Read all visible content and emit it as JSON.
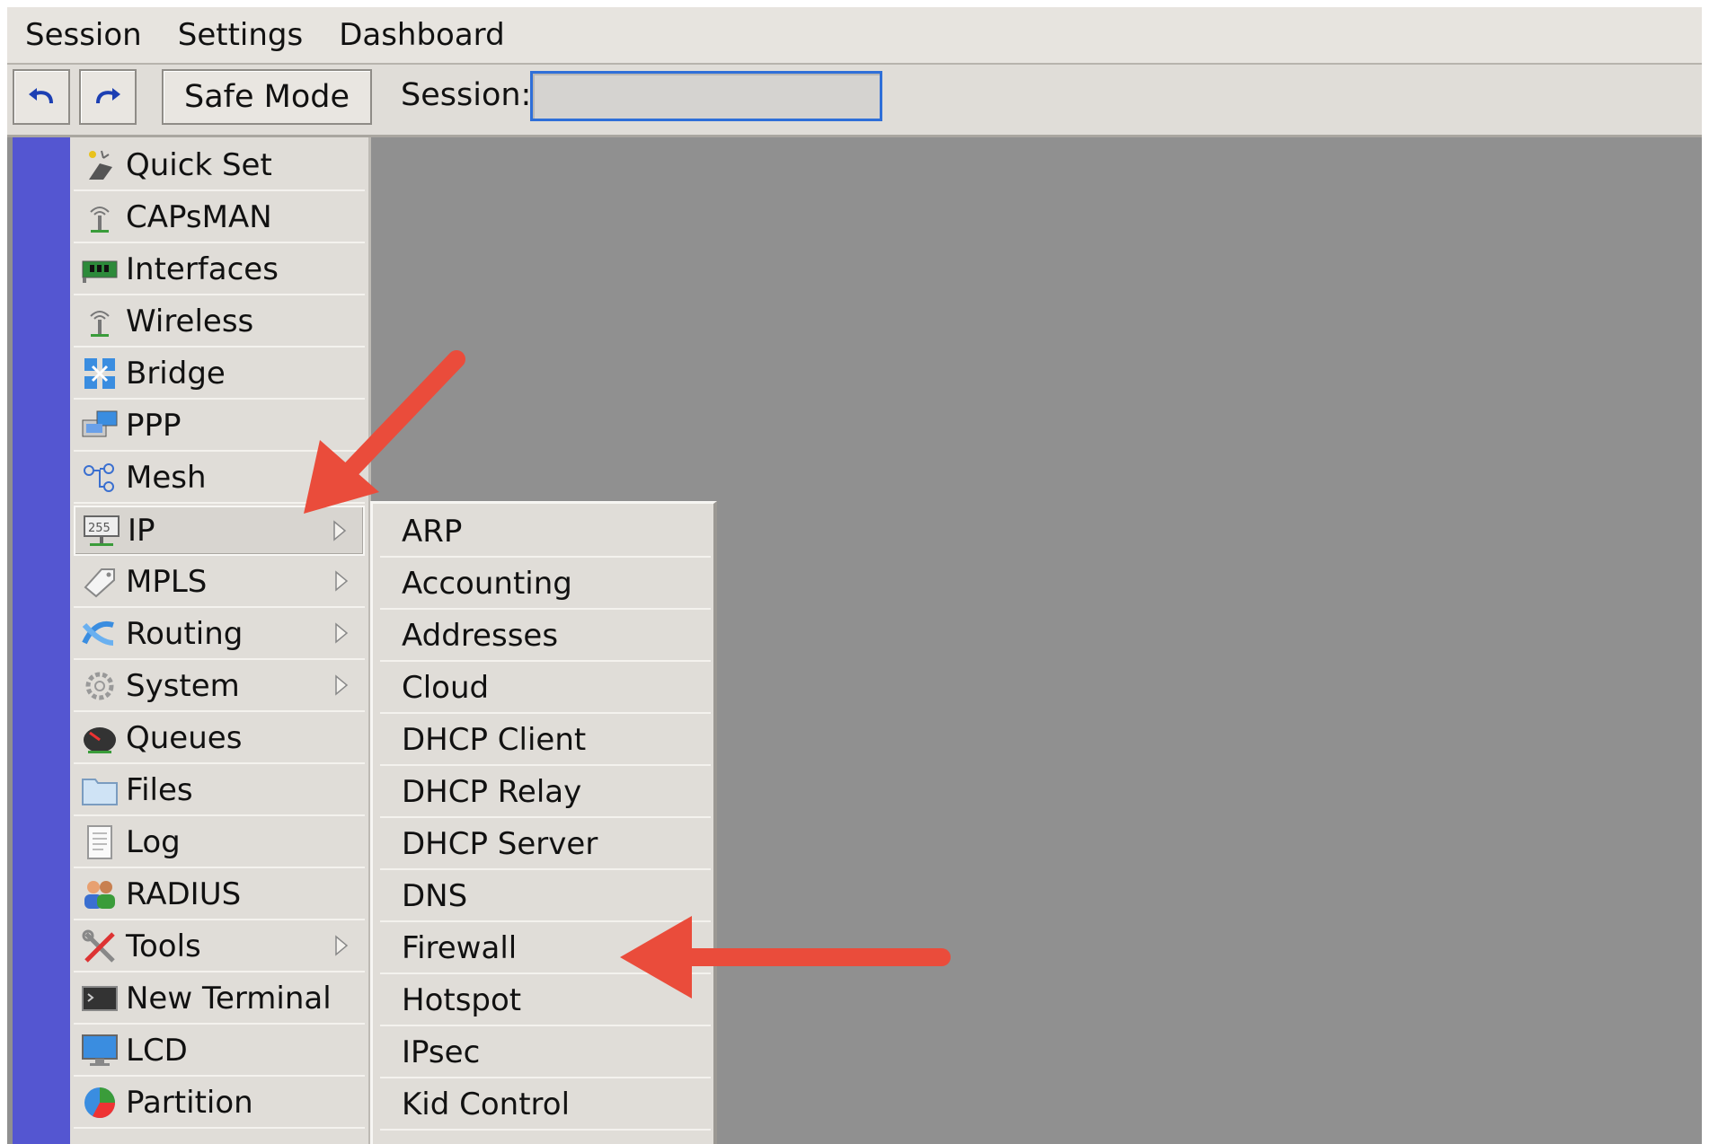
{
  "menubar": {
    "items": [
      {
        "label": "Session"
      },
      {
        "label": "Settings"
      },
      {
        "label": "Dashboard"
      }
    ]
  },
  "toolbar": {
    "undo_icon": "undo-icon",
    "redo_icon": "redo-icon",
    "safe_mode_label": "Safe Mode",
    "session_label": "Session:",
    "session_value": ""
  },
  "main_menu": {
    "items": [
      {
        "label": "Quick Set",
        "icon": "wand-icon",
        "has_submenu": false
      },
      {
        "label": "CAPsMAN",
        "icon": "antenna-icon",
        "has_submenu": false
      },
      {
        "label": "Interfaces",
        "icon": "network-card-icon",
        "has_submenu": false
      },
      {
        "label": "Wireless",
        "icon": "wireless-icon",
        "has_submenu": false
      },
      {
        "label": "Bridge",
        "icon": "bridge-icon",
        "has_submenu": false
      },
      {
        "label": "PPP",
        "icon": "ppp-icon",
        "has_submenu": false
      },
      {
        "label": "Mesh",
        "icon": "mesh-icon",
        "has_submenu": false
      },
      {
        "label": "IP",
        "icon": "ip-icon",
        "has_submenu": true,
        "selected": true
      },
      {
        "label": "MPLS",
        "icon": "tag-icon",
        "has_submenu": true
      },
      {
        "label": "Routing",
        "icon": "routing-icon",
        "has_submenu": true
      },
      {
        "label": "System",
        "icon": "gear-icon",
        "has_submenu": true
      },
      {
        "label": "Queues",
        "icon": "gauge-icon",
        "has_submenu": false
      },
      {
        "label": "Files",
        "icon": "folder-icon",
        "has_submenu": false
      },
      {
        "label": "Log",
        "icon": "document-icon",
        "has_submenu": false
      },
      {
        "label": "RADIUS",
        "icon": "users-icon",
        "has_submenu": false
      },
      {
        "label": "Tools",
        "icon": "tools-icon",
        "has_submenu": true
      },
      {
        "label": "New Terminal",
        "icon": "terminal-icon",
        "has_submenu": false
      },
      {
        "label": "LCD",
        "icon": "monitor-icon",
        "has_submenu": false
      },
      {
        "label": "Partition",
        "icon": "pie-icon",
        "has_submenu": false
      }
    ]
  },
  "submenu": {
    "items": [
      {
        "label": "ARP"
      },
      {
        "label": "Accounting"
      },
      {
        "label": "Addresses"
      },
      {
        "label": "Cloud"
      },
      {
        "label": "DHCP Client"
      },
      {
        "label": "DHCP Relay"
      },
      {
        "label": "DHCP Server"
      },
      {
        "label": "DNS"
      },
      {
        "label": "Firewall"
      },
      {
        "label": "Hotspot"
      },
      {
        "label": "IPsec"
      },
      {
        "label": "Kid Control"
      }
    ]
  },
  "colors": {
    "side_strip": "#5456d1",
    "annotation_arrow": "#ea4c3b",
    "workspace": "#909090"
  }
}
